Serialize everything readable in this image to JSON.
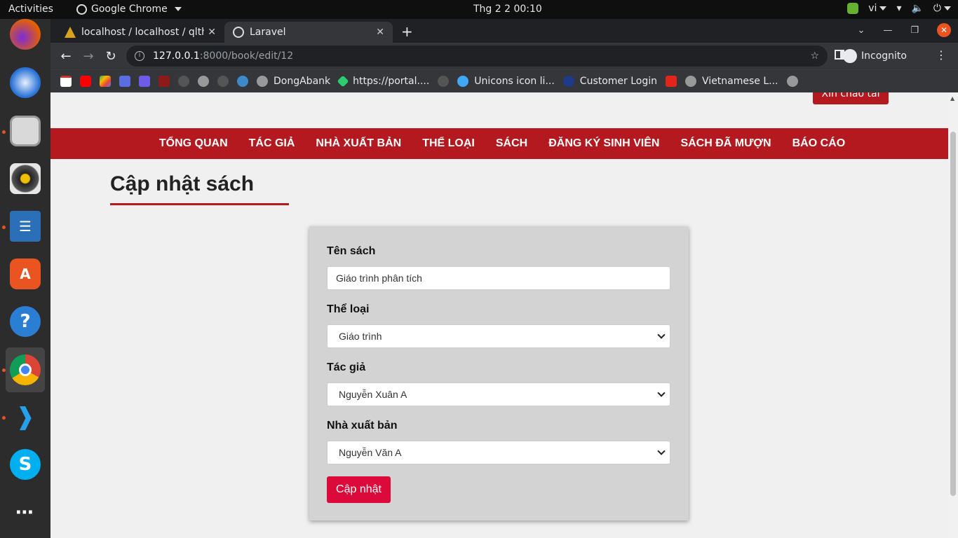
{
  "topbar": {
    "activities": "Activities",
    "app_name": "Google Chrome",
    "clock": "Thg 2 2  00:10",
    "lang": "vi"
  },
  "dock": {
    "apps": [
      "firefox-icon",
      "thunderbird-icon",
      "files-icon",
      "rhythmbox-icon",
      "writer-icon",
      "software-center-icon",
      "help-icon",
      "chrome-icon",
      "vscode-icon",
      "skype-icon",
      "app-grid-icon"
    ]
  },
  "browser": {
    "tabs": [
      {
        "title": "localhost / localhost / qlth"
      },
      {
        "title": "Laravel"
      }
    ],
    "url_host": "127.0.0.1",
    "url_path": ":8000/book/edit/12",
    "incognito_label": "Incognito",
    "bookmarks": [
      "DongAbank",
      "https://portal....",
      "Unicons icon li...",
      "Customer Login",
      "Vietnamese L..."
    ]
  },
  "page": {
    "greeting": "Xin chào tài",
    "nav": [
      "TỔNG QUAN",
      "TÁC GIẢ",
      "NHÀ XUẤT BẢN",
      "THỂ LOẠI",
      "SÁCH",
      "ĐĂNG KÝ SINH VIÊN",
      "SÁCH ĐÃ MƯỢN",
      "BÁO CÁO"
    ],
    "title": "Cập nhật sách",
    "form": {
      "name_label": "Tên sách",
      "name_value": "Giáo trình phân tích",
      "category_label": "Thể loại",
      "category_value": "Giáo trình",
      "author_label": "Tác giả",
      "author_value": "Nguyễn Xuân A",
      "publisher_label": "Nhà xuất bản",
      "publisher_value": "Nguyễn Văn A",
      "submit_label": "Cập nhật"
    }
  },
  "colors": {
    "brand_red": "#b3191e",
    "submit_red": "#dc0a3a",
    "card_bg": "#d3d3d3"
  }
}
